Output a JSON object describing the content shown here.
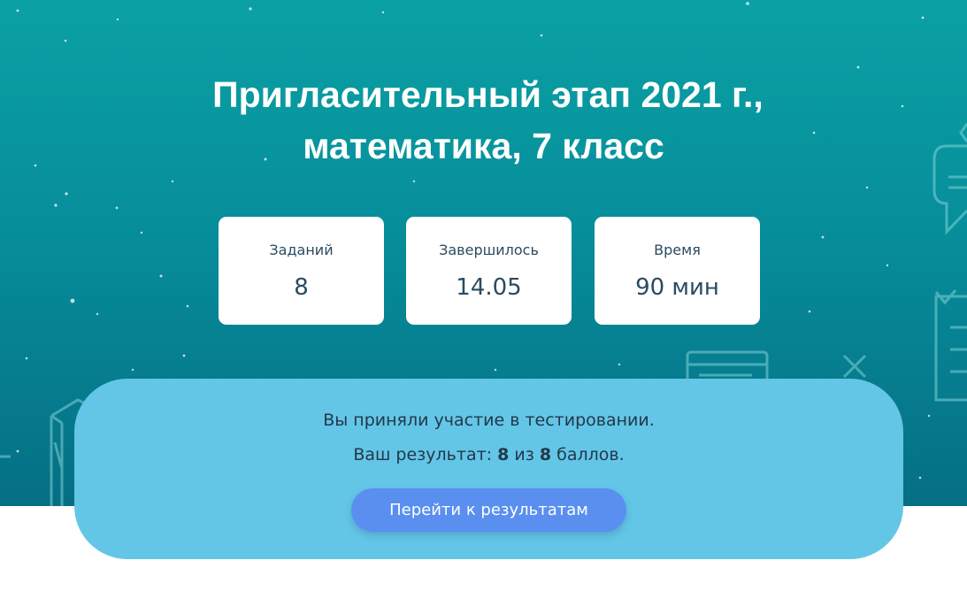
{
  "page": {
    "title_line1": "Пригласительный этап 2021 г.,",
    "title_line2": "математика, 7 класс"
  },
  "info_cards": [
    {
      "label": "Заданий",
      "value": "8"
    },
    {
      "label": "Завершилось",
      "value": "14.05"
    },
    {
      "label": "Время",
      "value": "90 мин"
    }
  ],
  "result": {
    "message": "Вы приняли участие в тестировании.",
    "score_prefix": "Ваш результат: ",
    "score": "8",
    "score_separator": " из ",
    "max_score": "8",
    "score_suffix": " баллов.",
    "button_label": "Перейти к результатам"
  },
  "colors": {
    "hero_top": "#0aa1a4",
    "hero_bottom": "#056f84",
    "panel": "#63c6e6",
    "button": "#5a8ff0",
    "card_text": "#2a4b61"
  },
  "icons": [
    "chat-bubble-icon",
    "checklist-icon",
    "browser-window-icon",
    "cross-icon",
    "cube-icon"
  ]
}
